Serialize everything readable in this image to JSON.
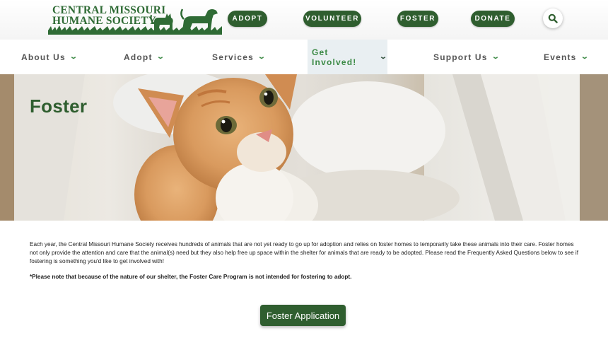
{
  "header": {
    "logo_line1": "CENTRAL MISSOURI",
    "logo_line2": "HUMANE SOCIETY",
    "buttons": {
      "adopt": "ADOPT",
      "volunteer": "VOLUNTEER",
      "foster": "FOSTER",
      "donate": "DONATE"
    },
    "search_icon": "search-icon"
  },
  "nav": {
    "items": [
      {
        "label": "About Us"
      },
      {
        "label": "Adopt"
      },
      {
        "label": "Services"
      },
      {
        "label": "Get Involved!",
        "active": true
      },
      {
        "label": "Support Us"
      },
      {
        "label": "Events"
      }
    ],
    "chevron_icon": "chevron-down-icon"
  },
  "hero": {
    "title": "Foster",
    "image": "orange-and-white-kitten-photo"
  },
  "content": {
    "intro": "Each year, the Central Missouri Humane Society receives hundreds of animals that are not yet ready to go up for adoption and relies on foster homes to temporarily take these animals into their care. Foster homes not only provide the attention and care that the animal(s) need but they also help free up space within the shelter for animals that are ready to be adopted. Please read the Frequently Asked Questions below to see if fostering is something you'd like to get involved with!",
    "note": "*Please note that because of the nature of our shelter, the Foster Care Program is not intended for fostering to adopt.",
    "apply_button": "Foster Application"
  },
  "colors": {
    "brand_green": "#2f5e2f",
    "accent_green": "#3c8a46",
    "active_nav_bg": "#e9eff2"
  }
}
